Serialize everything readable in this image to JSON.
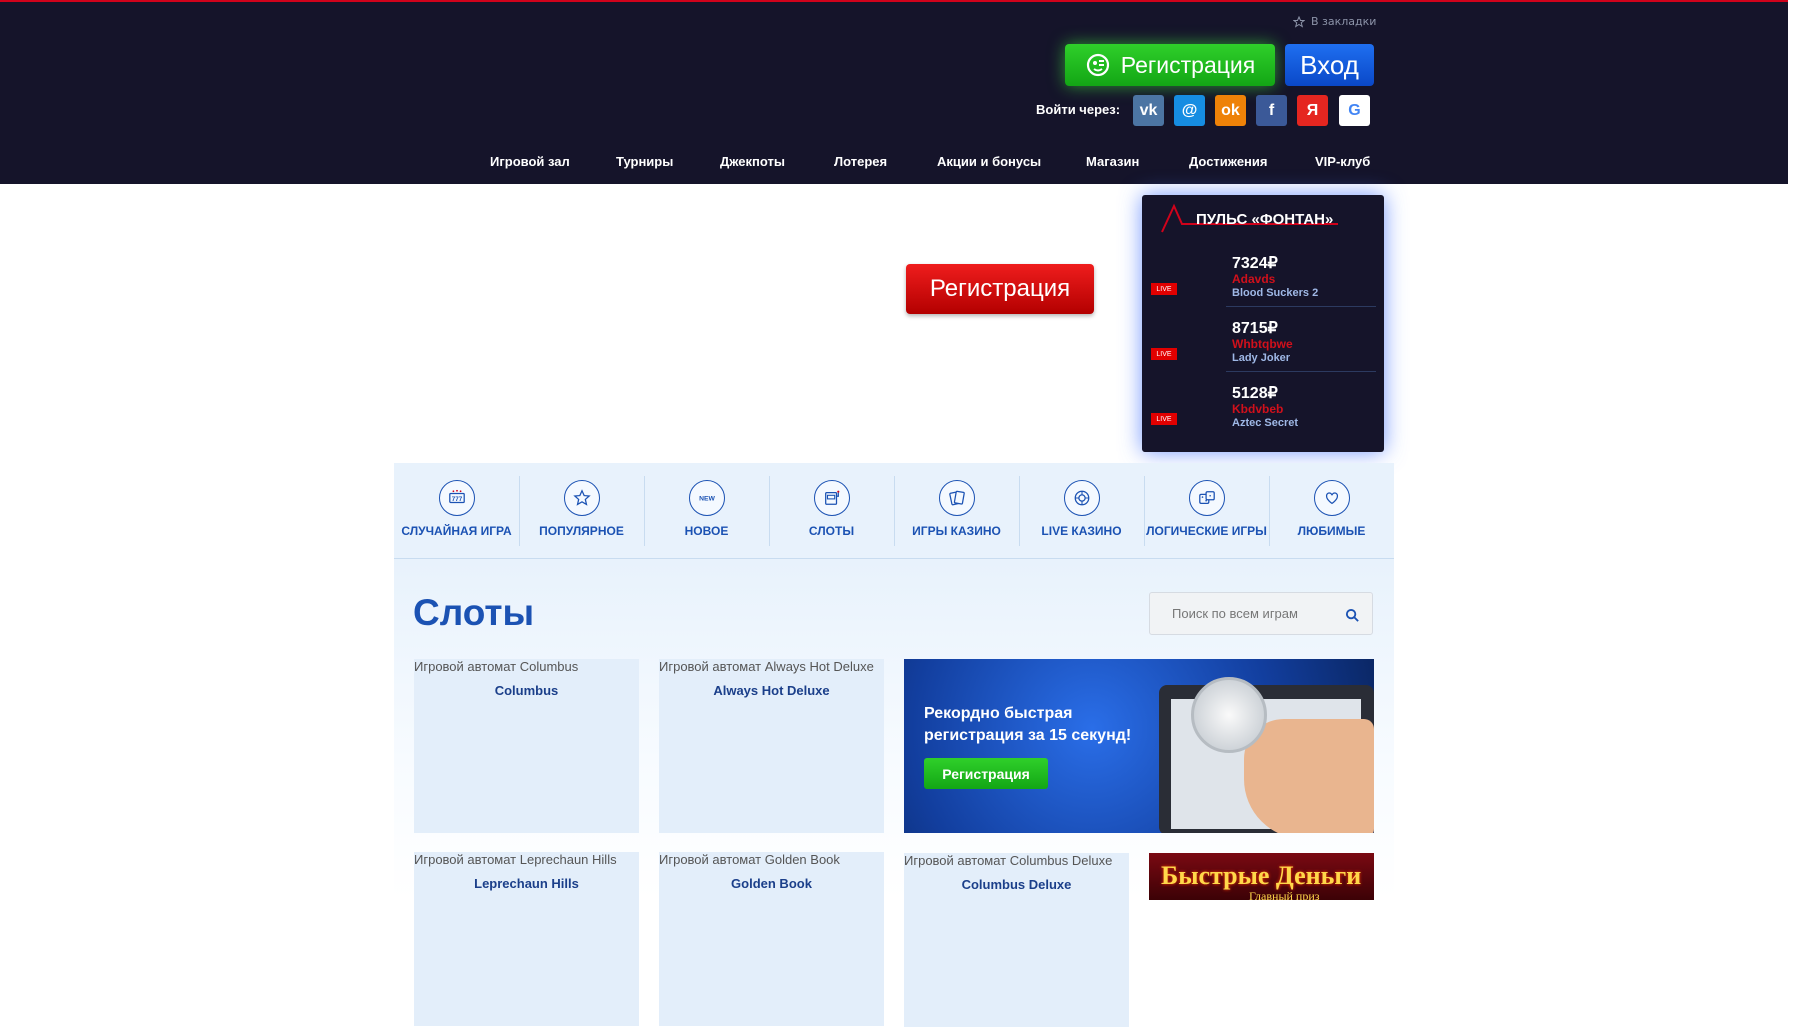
{
  "header": {
    "bookmark_label": "В закладки",
    "register_label": "Регистрация",
    "login_label": "Вход",
    "login_via_label": "Войти через:",
    "social": [
      {
        "name": "vk",
        "glyph": "vk",
        "color": "#4c75a3"
      },
      {
        "name": "mail",
        "glyph": "@",
        "color": "#168de2"
      },
      {
        "name": "odnoklassniki",
        "glyph": "ok",
        "color": "#ee8208"
      },
      {
        "name": "facebook",
        "glyph": "f",
        "color": "#3b5998"
      },
      {
        "name": "yandex",
        "glyph": "Я",
        "color": "#e52620"
      },
      {
        "name": "google",
        "glyph": "G",
        "color": "#ffffff"
      }
    ]
  },
  "nav": {
    "items": [
      "Игровой зал",
      "Турниры",
      "Джекпоты",
      "Лотерея",
      "Акции и бонусы",
      "Магазин",
      "Достижения",
      "VIP-клуб"
    ]
  },
  "hero": {
    "register_label": "Регистрация"
  },
  "pulse": {
    "title": "ПУЛЬС «ФОНТАН»",
    "live_label": "LIVE",
    "wins": [
      {
        "amount": "7324₽",
        "user": "Adavds",
        "game": "Blood Suckers 2"
      },
      {
        "amount": "8715₽",
        "user": "Whbtqbwe",
        "game": "Lady Joker"
      },
      {
        "amount": "5128₽",
        "user": "Kbdvbeb",
        "game": "Aztec Secret"
      }
    ]
  },
  "categories": [
    {
      "label": "СЛУЧАЙНАЯ ИГРА",
      "icon": "slot-777-icon"
    },
    {
      "label": "ПОПУЛЯРНОЕ",
      "icon": "star-icon"
    },
    {
      "label": "НОВОЕ",
      "icon": "new-icon"
    },
    {
      "label": "СЛОТЫ",
      "icon": "slot-machine-icon"
    },
    {
      "label": "ИГРЫ КАЗИНО",
      "icon": "cards-icon"
    },
    {
      "label": "LIVE КАЗИНО",
      "icon": "roulette-icon"
    },
    {
      "label": "ЛОГИЧЕСКИЕ ИГРЫ",
      "icon": "dice-icon"
    },
    {
      "label": "ЛЮБИМЫЕ",
      "icon": "heart-icon"
    }
  ],
  "main": {
    "title": "Слоты",
    "search_placeholder": "Поиск по всем играм",
    "games_row1": [
      {
        "caption": "Игровой автомат Columbus",
        "name": "Columbus"
      },
      {
        "caption": "Игровой автомат Always Hot Deluxe",
        "name": "Always Hot Deluxe"
      }
    ],
    "games_row2": [
      {
        "caption": "Игровой автомат Leprechaun Hills",
        "name": "Leprechaun Hills"
      },
      {
        "caption": "Игровой автомат Golden Book",
        "name": "Golden Book"
      },
      {
        "caption": "Игровой автомат Columbus Deluxe",
        "name": "Columbus Deluxe"
      }
    ],
    "promo": {
      "text": "Рекордно быстрая регистрация за 15 секунд!",
      "button": "Регистрация"
    },
    "ad": {
      "title": "Быстрые Деньги",
      "subtitle": "Главный приз"
    }
  },
  "colors": {
    "header_bg": "#15142a",
    "accent_blue": "#1b52b3",
    "register_green": "#13a615",
    "hero_red": "#d50000"
  }
}
